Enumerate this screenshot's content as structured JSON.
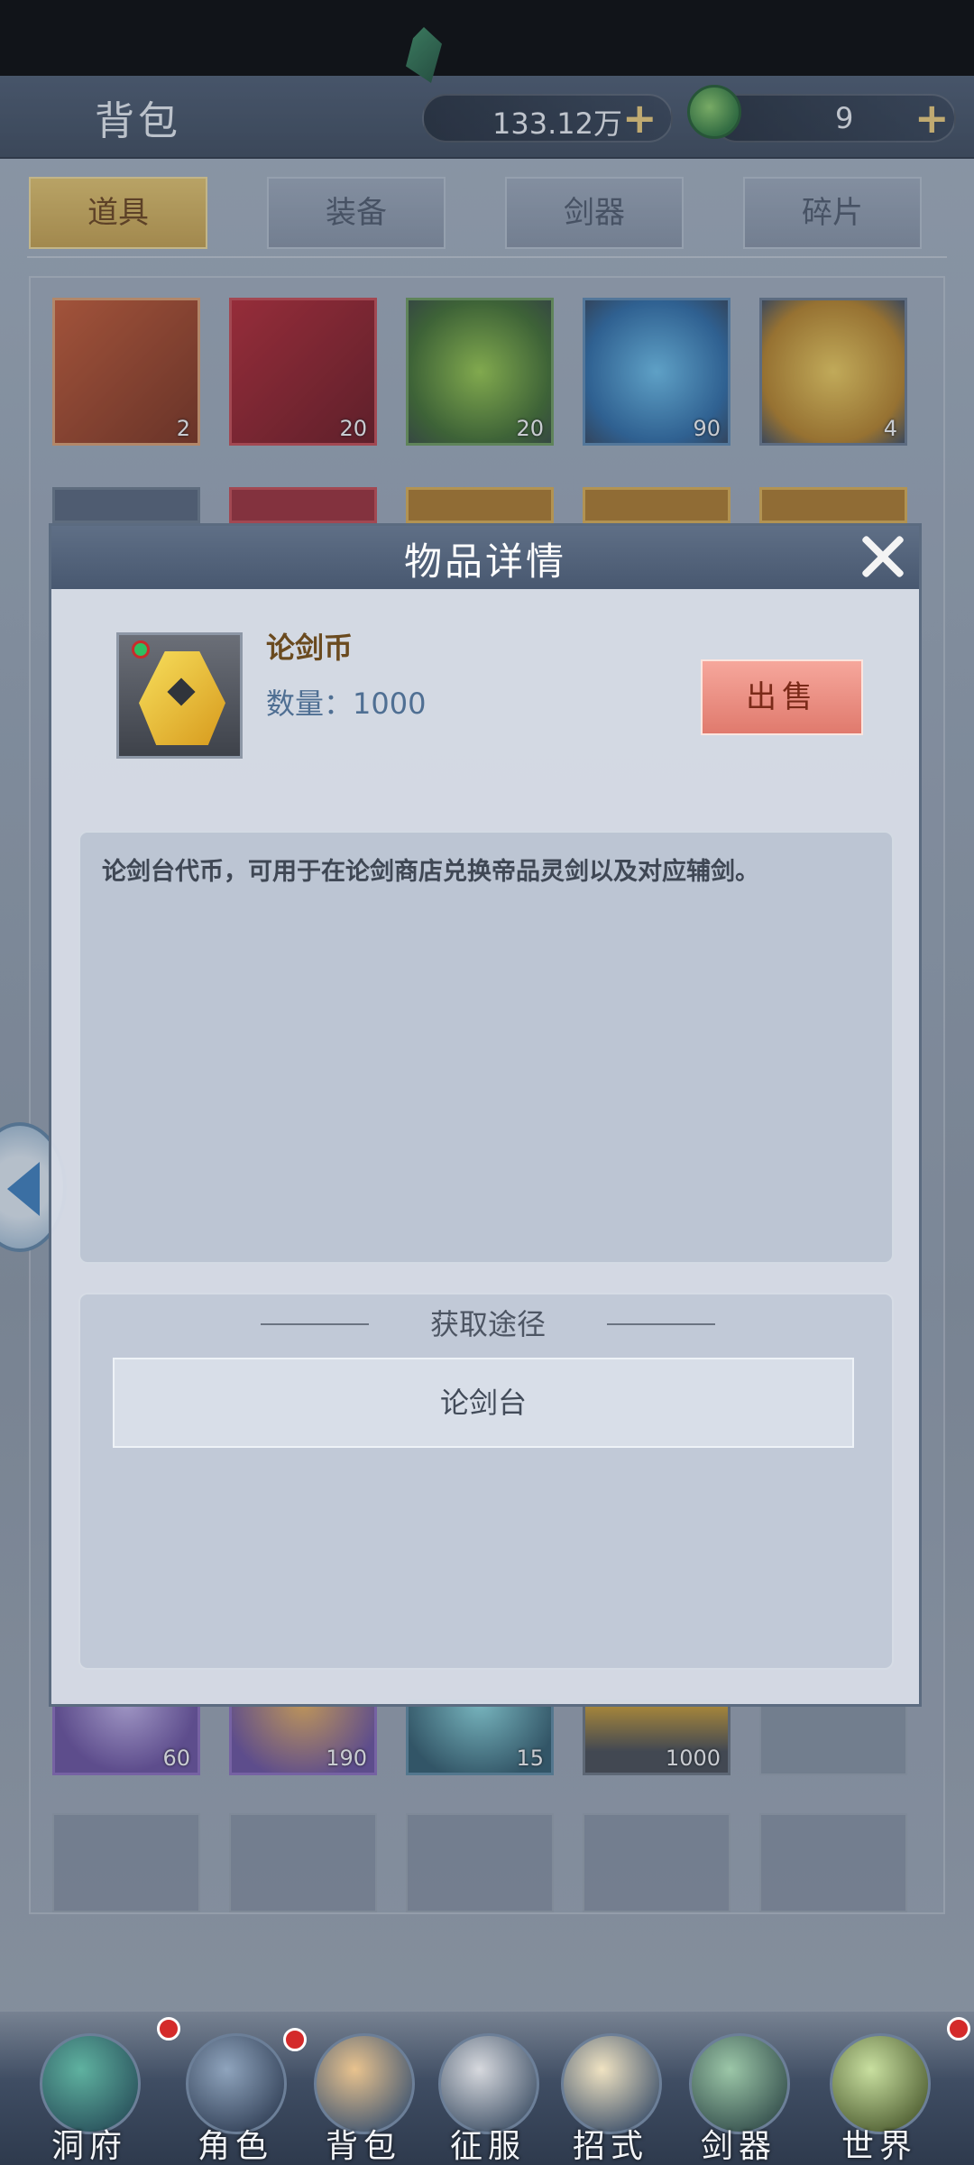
{
  "header": {
    "title": "背包",
    "currency_amount": "133.12万",
    "jade_amount": "9",
    "plus_glyph": "+"
  },
  "tabs": [
    {
      "label": "道具",
      "active": true
    },
    {
      "label": "装备",
      "active": false
    },
    {
      "label": "剑器",
      "active": false
    },
    {
      "label": "碎片",
      "active": false
    }
  ],
  "inventory": {
    "row1_counts": [
      "2",
      "20",
      "20",
      "90",
      "4"
    ],
    "row3_counts": [
      "60",
      "190",
      "15",
      "1000",
      ""
    ]
  },
  "modal": {
    "title": "物品详情",
    "item_name": "论剑币",
    "item_quantity": "数量：1000",
    "sell_label": "出售",
    "description": "论剑台代币，可用于在论剑商店兑换帝品灵剑以及对应辅剑。",
    "source_heading": "获取途径",
    "sources": [
      "论剑台"
    ]
  },
  "bottom_nav": [
    {
      "label": "洞府",
      "badge": true
    },
    {
      "label": "角色",
      "badge": true
    },
    {
      "label": "背包",
      "badge": false
    },
    {
      "label": "征服",
      "badge": false
    },
    {
      "label": "招式",
      "badge": false
    },
    {
      "label": "剑器",
      "badge": false
    },
    {
      "label": "世界",
      "badge": true
    }
  ],
  "colors": {
    "active_tab": "#e8c66a",
    "sell_button": "#f0917f",
    "badge": "#d42a2a"
  }
}
